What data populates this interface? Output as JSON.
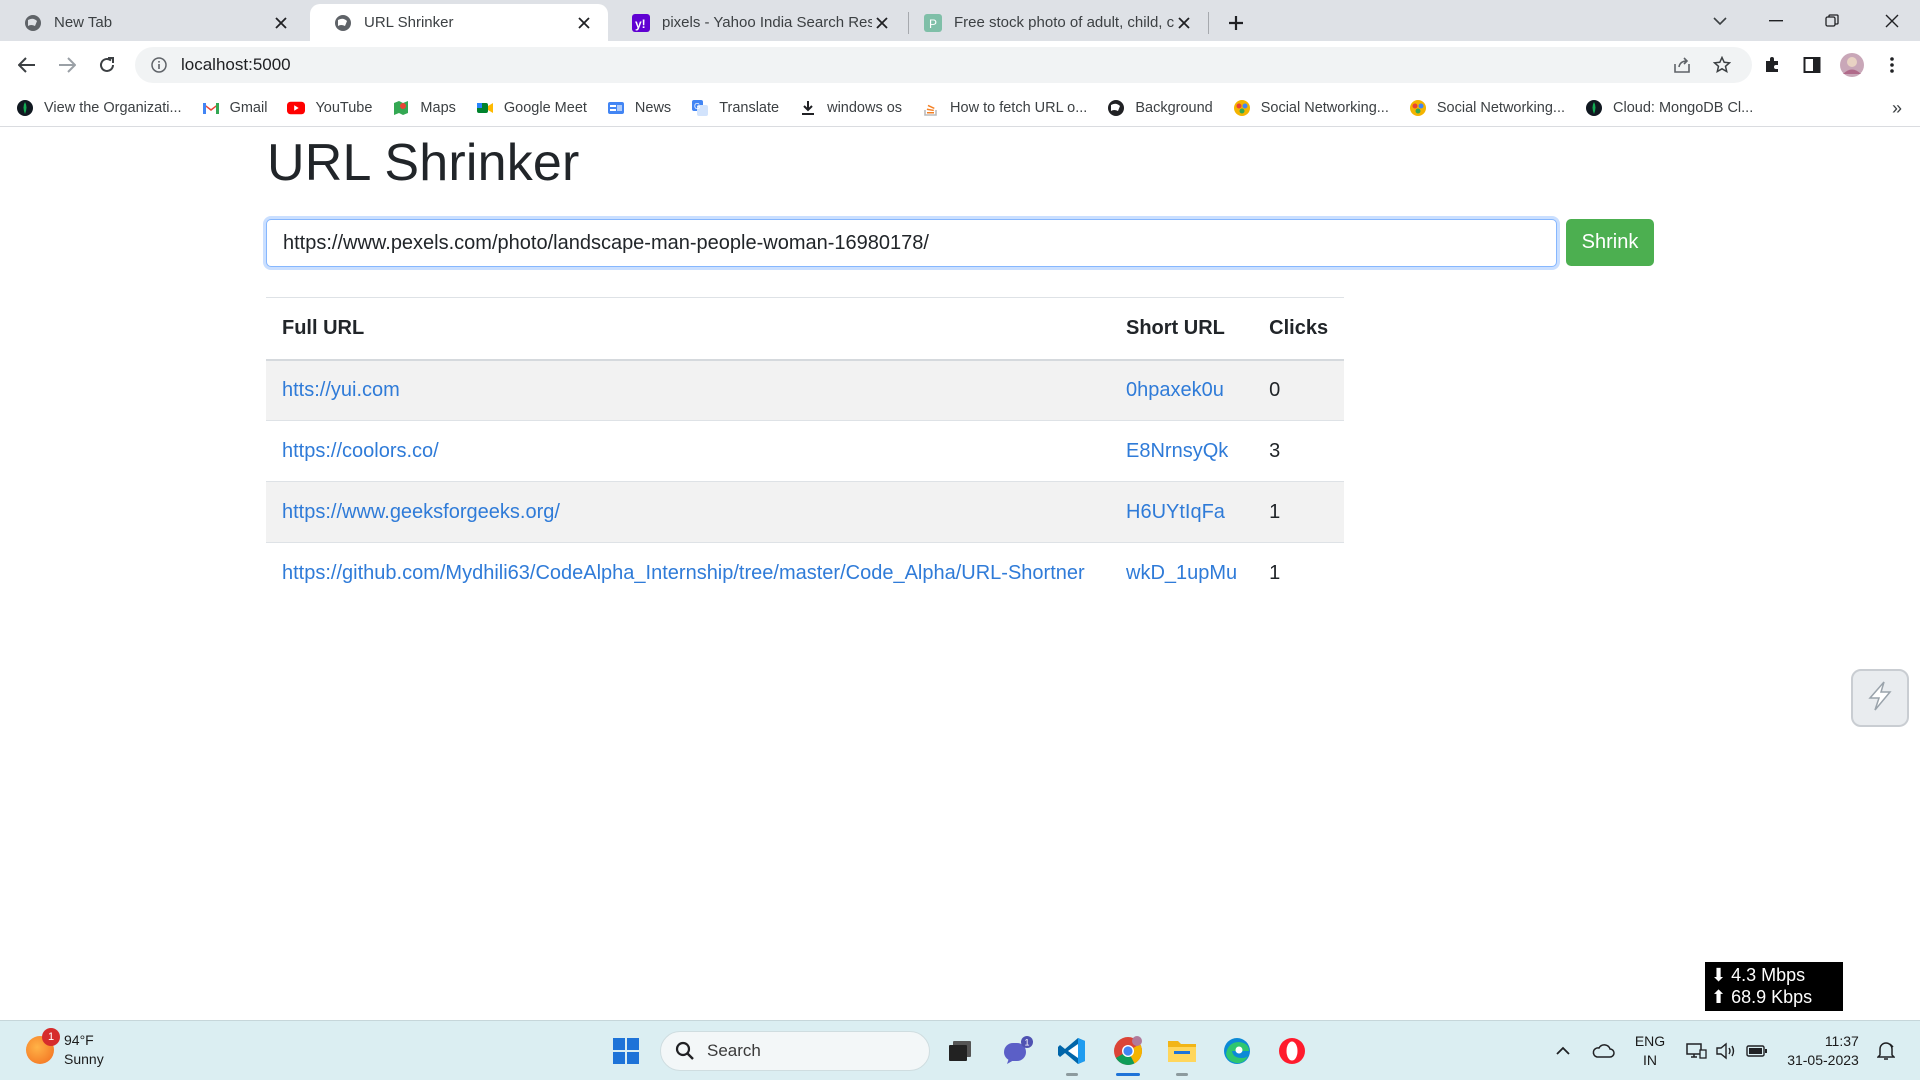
{
  "browser": {
    "tabs": [
      {
        "title": "New Tab",
        "active": false
      },
      {
        "title": "URL Shrinker",
        "active": true
      },
      {
        "title": "pixels - Yahoo India Search Resul",
        "active": false
      },
      {
        "title": "Free stock photo of adult, child, c",
        "active": false
      }
    ],
    "address": "localhost:5000",
    "bookmarks": [
      {
        "label": "View the Organizati...",
        "icon": "mongodb-leaf-icon"
      },
      {
        "label": "Gmail",
        "icon": "gmail-icon"
      },
      {
        "label": "YouTube",
        "icon": "youtube-icon"
      },
      {
        "label": "Maps",
        "icon": "maps-icon"
      },
      {
        "label": "Google Meet",
        "icon": "google-meet-icon"
      },
      {
        "label": "News",
        "icon": "news-icon"
      },
      {
        "label": "Translate",
        "icon": "translate-icon"
      },
      {
        "label": "windows os",
        "icon": "download-icon"
      },
      {
        "label": "How to fetch URL o...",
        "icon": "stackoverflow-icon"
      },
      {
        "label": "Background",
        "icon": "globe-icon"
      },
      {
        "label": "Social Networking...",
        "icon": "bookmark-site-icon"
      },
      {
        "label": "Social Networking...",
        "icon": "bookmark-site-icon"
      },
      {
        "label": "Cloud: MongoDB Cl...",
        "icon": "mongodb-leaf-icon"
      }
    ],
    "bookmarks_more": "»"
  },
  "page": {
    "title": "URL Shrinker",
    "input_value": "https://www.pexels.com/photo/landscape-man-people-woman-16980178/",
    "shrink_label": "Shrink",
    "table": {
      "headers": {
        "full": "Full URL",
        "short": "Short URL",
        "clicks": "Clicks"
      },
      "rows": [
        {
          "full": "htts://yui.com",
          "short": "0hpaxek0u",
          "clicks": "0"
        },
        {
          "full": "https://coolors.co/",
          "short": "E8NrnsyQk",
          "clicks": "3"
        },
        {
          "full": "https://www.geeksforgeeks.org/",
          "short": "H6UYtIqFa",
          "clicks": "1"
        },
        {
          "full": "https://github.com/Mydhili63/CodeAlpha_Internship/tree/master/Code_Alpha/URL-Shortner",
          "short": "wkD_1upMu",
          "clicks": "1"
        }
      ]
    }
  },
  "netmeter": {
    "down": "⬇ 4.3 Mbps",
    "up": "⬆ 68.9 Kbps"
  },
  "taskbar": {
    "weather": {
      "temp": "94°F",
      "condition": "Sunny",
      "badge": "1"
    },
    "search_label": "Search",
    "teams_badge": "1",
    "lang_line1": "ENG",
    "lang_line2": "IN",
    "time": "11:37",
    "date": "31-05-2023"
  },
  "colors": {
    "link": "#2f7bd8",
    "shrink_button": "#4caf50",
    "tabstrip": "#dee1e6",
    "taskbar": "#dbeef2"
  }
}
